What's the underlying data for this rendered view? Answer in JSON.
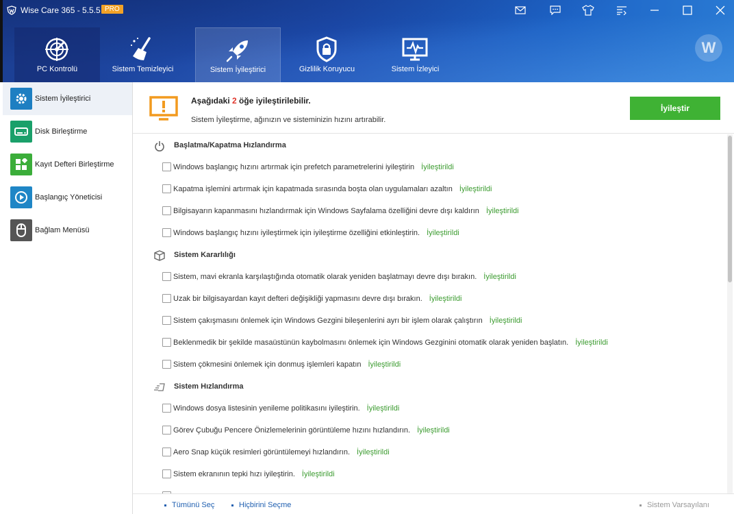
{
  "window": {
    "title": "Wise Care 365 - 5.5.5",
    "badge": "PRO"
  },
  "tabs": [
    {
      "label": "PC Kontrolü",
      "icon": "radar-icon"
    },
    {
      "label": "Sistem Temizleyici",
      "icon": "broom-icon"
    },
    {
      "label": "Sistem İyileştirici",
      "icon": "rocket-icon",
      "active": true
    },
    {
      "label": "Gizlilik Koruyucu",
      "icon": "privacy-lock-icon"
    },
    {
      "label": "Sistem İzleyici",
      "icon": "monitor-pulse-icon"
    }
  ],
  "avatar_initial": "W",
  "sidebar": {
    "items": [
      {
        "label": "Sistem İyileştirici",
        "icon": "gear-icon",
        "color": "#1e7fc2"
      },
      {
        "label": "Disk Birleştirme",
        "icon": "disk-icon",
        "color": "#1aa06a"
      },
      {
        "label": "Kayıt Defteri Birleştirme",
        "icon": "registry-blocks-icon",
        "color": "#3bad3a"
      },
      {
        "label": "Başlangıç Yöneticisi",
        "icon": "play-icon",
        "color": "#1f86c6"
      },
      {
        "label": "Bağlam Menüsü",
        "icon": "mouse-icon",
        "color": "#555555"
      }
    ]
  },
  "summary": {
    "title_prefix": "Aşağıdaki ",
    "count": "2",
    "title_suffix": " öğe iyileştirilebilir.",
    "subtitle": "Sistem İyileştirme, ağınızın ve sisteminizin hızını artırabilir.",
    "button": "İyileştir"
  },
  "sections": [
    {
      "title": "Başlatma/Kapatma Hızlandırma",
      "icon": "power-icon",
      "items": [
        {
          "text": "Windows başlangıç hızını artırmak için prefetch parametrelerini iyileştirin",
          "status": "İyileştirildi"
        },
        {
          "text": "Kapatma işlemini artırmak için kapatmada sırasında boşta olan uygulamaları azaltın",
          "status": "İyileştirildi"
        },
        {
          "text": "Bilgisayarın kapanmasını hızlandırmak için Windows Sayfalama özelliğini devre dışı kaldırın",
          "status": "İyileştirildi"
        },
        {
          "text": "Windows başlangıç hızını iyileştirmek için iyileştirme özelliğini etkinleştirin.",
          "status": "İyileştirildi"
        }
      ]
    },
    {
      "title": "Sistem Kararlılığı",
      "icon": "cube-icon",
      "items": [
        {
          "text": "Sistem, mavi ekranla karşılaştığında otomatik olarak yeniden başlatmayı devre dışı bırakın.",
          "status": "İyileştirildi"
        },
        {
          "text": "Uzak bir bilgisayardan kayıt defteri değişikliği yapmasını devre dışı bırakın.",
          "status": "İyileştirildi"
        },
        {
          "text": "Sistem çakışmasını önlemek için Windows Gezgini bileşenlerini ayrı bir işlem olarak çalıştırın",
          "status": "İyileştirildi"
        },
        {
          "text": "Beklenmedik bir şekilde masaüstünün kaybolmasını önlemek için Windows Gezginini otomatik olarak yeniden başlatın.",
          "status": "İyileştirildi"
        },
        {
          "text": "Sistem çökmesini önlemek için donmuş işlemleri kapatın",
          "status": "İyileştirildi"
        }
      ]
    },
    {
      "title": "Sistem Hızlandırma",
      "icon": "3d-speed-icon",
      "items": [
        {
          "text": "Windows dosya listesinin yenileme politikasını iyileştirin.",
          "status": "İyileştirildi"
        },
        {
          "text": "Görev Çubuğu Pencere Önizlemelerinin görüntüleme hızını hızlandırın.",
          "status": "İyileştirildi"
        },
        {
          "text": "Aero Snap küçük resimleri görüntülemeyi hızlandırın.",
          "status": "İyileştirildi"
        },
        {
          "text": "Sistem ekranının tepki hızı iyileştirin.",
          "status": "İyileştirildi"
        }
      ]
    }
  ],
  "footer": {
    "select_all": "Tümünü Seç",
    "select_none": "Hiçbirini Seçme",
    "defaults": "Sistem Varsayılanı"
  },
  "colors": {
    "accent_green": "#3fb234",
    "status_green": "#3b9b2f",
    "count_red": "#e0362c",
    "header_blue": "#1e4fb4",
    "warning_orange": "#f2a227"
  }
}
